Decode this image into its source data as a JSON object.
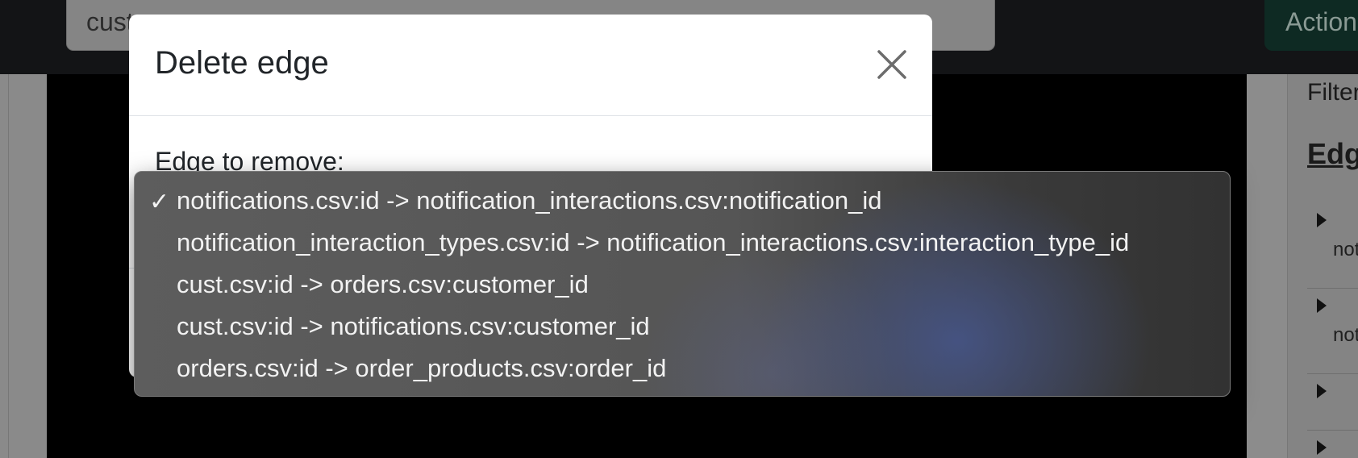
{
  "topbar": {
    "search_value": "cust",
    "actions_label": "Actions"
  },
  "modal": {
    "title": "Delete edge",
    "field_label": "Edge to remove:",
    "close_icon": "close-icon"
  },
  "dropdown": {
    "selected_index": 0,
    "options": [
      "notifications.csv:id -> notification_interactions.csv:notification_id",
      "notification_interaction_types.csv:id -> notification_interactions.csv:interaction_type_id",
      "cust.csv:id -> orders.csv:customer_id",
      "cust.csv:id -> notifications.csv:customer_id",
      "orders.csv:id -> order_products.csv:order_id"
    ]
  },
  "right_panel": {
    "filter_label": "Filter",
    "edges_heading": "Edges",
    "rows": [
      "not",
      "not",
      "",
      ""
    ]
  },
  "colors": {
    "modal_bg": "#ffffff",
    "dropdown_bg": "#555555",
    "actions_bg": "#0e2a23"
  }
}
